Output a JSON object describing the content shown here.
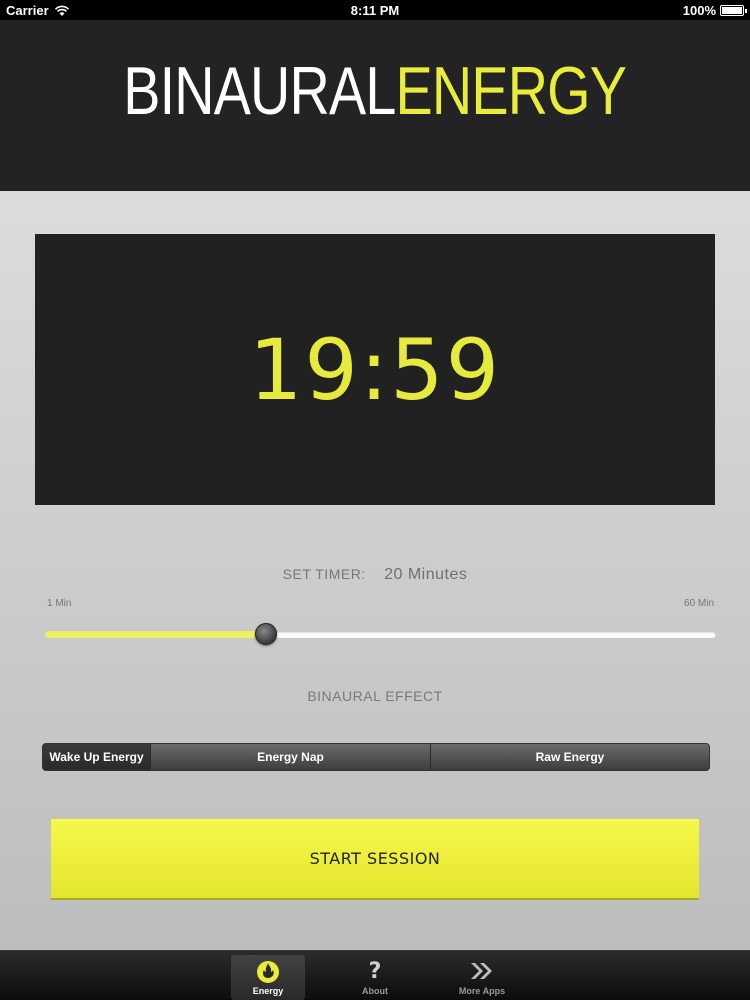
{
  "status_bar": {
    "carrier": "Carrier",
    "time": "8:11 PM",
    "battery": "100%"
  },
  "header": {
    "logo_part1": "BINAURAL",
    "logo_part2": "ENERGY"
  },
  "timer": {
    "display": "19:59"
  },
  "set_timer": {
    "label": "SET TIMER:",
    "value": "20 Minutes",
    "min_label": "1 Min",
    "max_label": "60 Min",
    "slider_fraction": 0.33
  },
  "binaural_effect": {
    "label": "BINAURAL EFFECT",
    "options": [
      "Wake Up Energy",
      "Energy Nap",
      "Raw Energy"
    ],
    "selected": "Wake Up Energy"
  },
  "start_button": {
    "label": "START SESSION"
  },
  "tab_bar": {
    "items": [
      {
        "label": "Energy",
        "icon": "flame-icon",
        "active": true
      },
      {
        "label": "About",
        "icon": "question-icon",
        "active": false
      },
      {
        "label": "More Apps",
        "icon": "double-chevron-icon",
        "active": false
      }
    ]
  },
  "colors": {
    "accent": "#e9ed3a",
    "header_bg": "#232325",
    "display_bg": "#212122"
  }
}
